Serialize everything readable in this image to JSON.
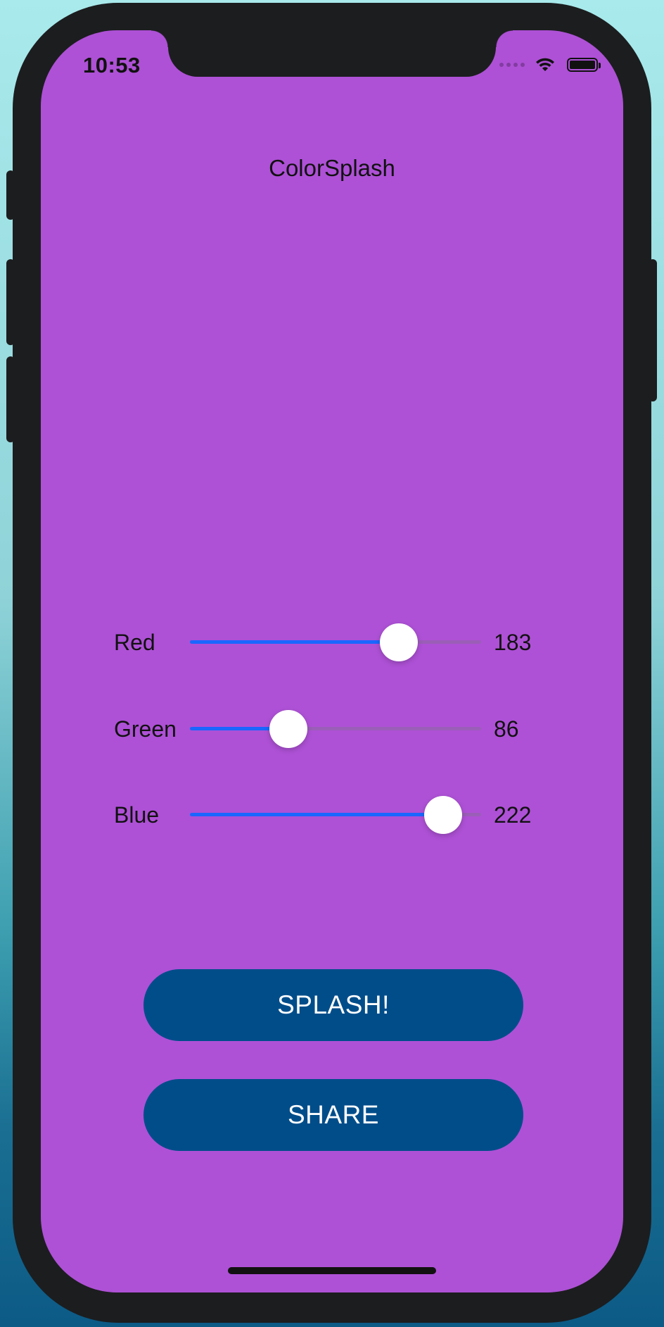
{
  "status_bar": {
    "time": "10:53",
    "icons": [
      "signal-dots-icon",
      "wifi-icon",
      "battery-icon"
    ]
  },
  "app": {
    "title": "ColorSplash",
    "background_color": "#ae51d6"
  },
  "sliders": [
    {
      "label": "Red",
      "value": "183",
      "fraction": 0.7176
    },
    {
      "label": "Green",
      "value": "86",
      "fraction": 0.3373
    },
    {
      "label": "Blue",
      "value": "222",
      "fraction": 0.8706
    }
  ],
  "buttons": {
    "splash_label": "SPLASH!",
    "share_label": "SHARE"
  },
  "colors": {
    "slider_fill": "#1a66ff",
    "button_bg": "#004d8a",
    "button_text": "#ffffff"
  }
}
